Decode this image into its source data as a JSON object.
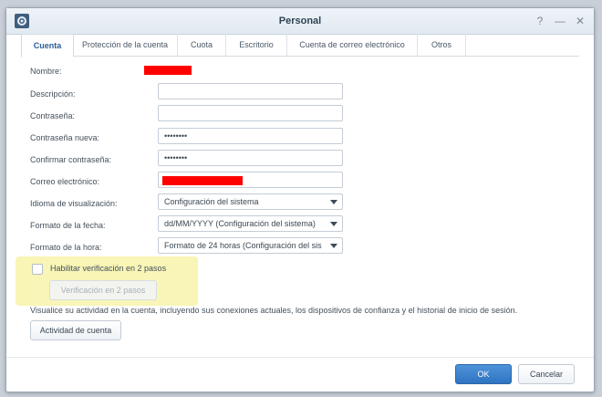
{
  "window": {
    "title": "Personal",
    "help_glyph": "?",
    "minimize_glyph": "—",
    "close_glyph": "✕"
  },
  "tabs": [
    {
      "label": "Cuenta",
      "active": true
    },
    {
      "label": "Protección de la cuenta",
      "active": false
    },
    {
      "label": "Cuota",
      "active": false
    },
    {
      "label": "Escritorio",
      "active": false
    },
    {
      "label": "Cuenta de correo electrónico",
      "active": false
    },
    {
      "label": "Otros",
      "active": false
    }
  ],
  "form": {
    "name_label": "Nombre:",
    "description_label": "Descripción:",
    "description_value": "",
    "password_label": "Contraseña:",
    "password_value": "",
    "new_password_label": "Contraseña nueva:",
    "new_password_value": "••••••••",
    "confirm_password_label": "Confirmar contraseña:",
    "confirm_password_value": "••••••••",
    "email_label": "Correo electrónico:",
    "language_label": "Idioma de visualización:",
    "language_value": "Configuración del sistema",
    "date_format_label": "Formato de la fecha:",
    "date_format_value": "dd/MM/YYYY (Configuración del sistema)",
    "time_format_label": "Formato de la hora:",
    "time_format_value": "Formato de 24 horas (Configuración del sis"
  },
  "two_step": {
    "checkbox_label": "Habilitar verificación en 2 pasos",
    "button_label": "Verificación en 2 pasos",
    "checked": false
  },
  "activity": {
    "description": "Visualice su actividad en la cuenta, incluyendo sus conexiones actuales, los dispositivos de confianza y el historial de inicio de sesión.",
    "button_label": "Actividad de cuenta"
  },
  "footer": {
    "ok_label": "OK",
    "cancel_label": "Cancelar"
  },
  "colors": {
    "accent": "#2f74c1",
    "redaction": "#ff0000",
    "highlight": "#f8f5b6"
  },
  "icons": {
    "app": "control-panel-icon",
    "dropdown": "chevron-down-icon"
  }
}
